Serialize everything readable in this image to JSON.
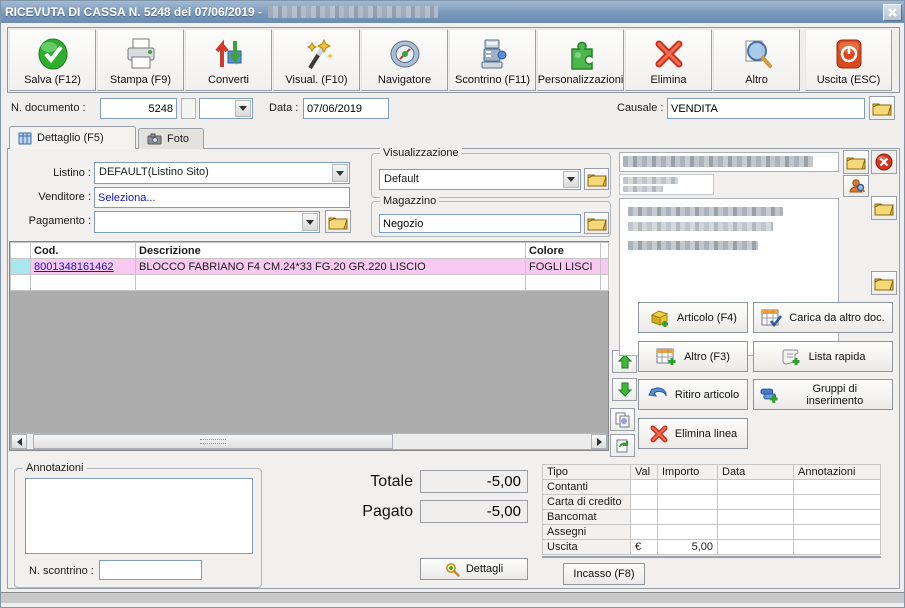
{
  "window": {
    "title": "RICEVUTA DI CASSA N. 5248 del 07/06/2019 -",
    "close_glyph": "×"
  },
  "colors": {
    "titlebar": "#7697ba",
    "row_highlight": "#f9c9f2",
    "row_marker": "#a9e7ef",
    "link": "#1414cc",
    "venditore_text": "#1414cc"
  },
  "toolbar": {
    "buttons": [
      {
        "label": "Salva (F12)",
        "icon": "save-check-icon"
      },
      {
        "label": "Stampa (F9)",
        "icon": "printer-icon"
      },
      {
        "label": "Converti",
        "icon": "convert-arrows-icon"
      },
      {
        "label": "Visual. (F10)",
        "icon": "magic-wand-icon"
      },
      {
        "label": "Navigatore",
        "icon": "compass-icon"
      },
      {
        "label": "Scontrino (F11)",
        "icon": "cash-register-icon"
      },
      {
        "label": "Personalizzazioni",
        "icon": "puzzle-icon"
      },
      {
        "label": "Elimina",
        "icon": "delete-x-icon"
      },
      {
        "label": "Altro",
        "icon": "magnifier-doc-icon"
      },
      {
        "label": "Uscita (ESC)",
        "icon": "power-icon"
      }
    ]
  },
  "doc_header": {
    "n_documento_label": "N. documento :",
    "n_documento_value": "5248",
    "data_label": "Data :",
    "data_value": "07/06/2019",
    "causale_label": "Causale :",
    "causale_value": "VENDITA"
  },
  "tabs": [
    {
      "label": "Dettaglio (F5)",
      "icon": "table-icon",
      "active": true
    },
    {
      "label": "Foto",
      "icon": "camera-icon",
      "active": false
    }
  ],
  "form": {
    "listino_label": "Listino :",
    "listino_value": "DEFAULT(Listino Sito)",
    "venditore_label": "Venditore :",
    "venditore_value": "Seleziona...",
    "pagamento_label": "Pagamento :",
    "pagamento_value": "",
    "visualizzazione_title": "Visualizzazione",
    "visualizzazione_value": "Default",
    "magazzino_title": "Magazzino",
    "magazzino_value": "Negozio"
  },
  "grid": {
    "headers": {
      "cod": "Cod.",
      "descrizione": "Descrizione",
      "colore": "Colore"
    },
    "rows": [
      {
        "cod": "8001348161462",
        "descrizione": "BLOCCO FABRIANO F4 CM.24*33 FG.20 GR.220 LISCIO",
        "colore": "FOGLI LISCI"
      }
    ]
  },
  "side_actions": {
    "articolo": {
      "label": "Articolo (F4)",
      "icon": "box-plus-icon"
    },
    "carica": {
      "label": "Carica da altro doc.",
      "icon": "grid-check-icon"
    },
    "altro": {
      "label": "Altro (F3)",
      "icon": "grid-plus-icon"
    },
    "lista": {
      "label": "Lista rapida",
      "icon": "list-plus-icon"
    },
    "ritiro": {
      "label": "Ritiro articolo",
      "icon": "undo-arrow-icon"
    },
    "gruppi": {
      "label": "Gruppi di inserimento",
      "icon": "group-plus-icon"
    },
    "elimina_linea": {
      "label": "Elimina linea",
      "icon": "red-x-icon"
    }
  },
  "bottom": {
    "annotazioni_title": "Annotazioni",
    "annotazioni_value": "",
    "n_scontrino_label": "N. scontrino :",
    "n_scontrino_value": "",
    "totale_label": "Totale",
    "totale_value": "-5,00",
    "pagato_label": "Pagato",
    "pagato_value": "-5,00",
    "dettagli_label": "Dettagli",
    "incasso_label": "Incasso (F8)"
  },
  "payments": {
    "headers": {
      "tipo": "Tipo",
      "val": "Val",
      "importo": "Importo",
      "data": "Data",
      "annotazioni": "Annotazioni"
    },
    "rows": [
      {
        "tipo": "Contanti",
        "val": "",
        "importo": "",
        "data": "",
        "annotazioni": ""
      },
      {
        "tipo": "Carta di credito",
        "val": "",
        "importo": "",
        "data": "",
        "annotazioni": ""
      },
      {
        "tipo": "Bancomat",
        "val": "",
        "importo": "",
        "data": "",
        "annotazioni": ""
      },
      {
        "tipo": "Assegni",
        "val": "",
        "importo": "",
        "data": "",
        "annotazioni": ""
      },
      {
        "tipo": "Uscita",
        "val": "€",
        "importo": "5,00",
        "data": "",
        "annotazioni": ""
      }
    ]
  }
}
